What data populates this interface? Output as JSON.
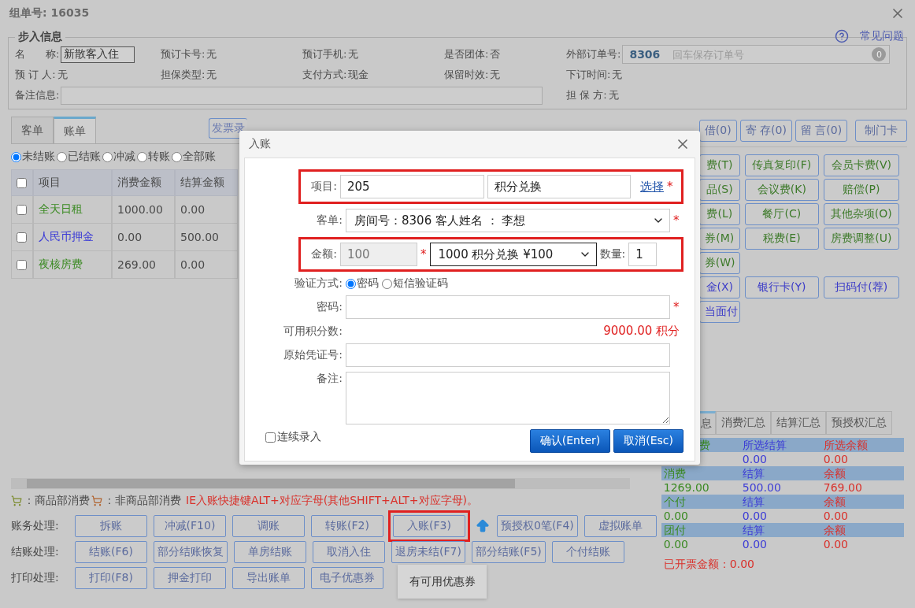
{
  "window": {
    "title": "组单号: 16035"
  },
  "help_link": "常见问题",
  "checkin_info": {
    "legend": "步入信息",
    "rows": [
      [
        {
          "kind": "input",
          "label": "名　　称:",
          "value": "新散客入住"
        },
        {
          "kind": "text",
          "label": "预订卡号:",
          "value": "无"
        },
        {
          "kind": "text",
          "label": "预订手机:",
          "value": "无"
        },
        {
          "kind": "text",
          "label": "是否团体:",
          "value": "否"
        },
        {
          "kind": "order",
          "label": "外部订单号:",
          "value": "8306",
          "placeholder": "回车保存订单号",
          "badge": "0"
        }
      ],
      [
        {
          "kind": "text",
          "label": "预 订 人:",
          "value": "无"
        },
        {
          "kind": "text",
          "label": "担保类型:",
          "value": "无"
        },
        {
          "kind": "text",
          "label": "支付方式:",
          "value": "现金"
        },
        {
          "kind": "text",
          "label": "保留时效:",
          "value": "无"
        },
        {
          "kind": "text",
          "label": "下订时间:",
          "value": "无"
        }
      ],
      [
        {
          "kind": "wide",
          "label": "备注信息:"
        },
        "",
        "",
        "",
        {
          "kind": "text",
          "label": "担 保 方:",
          "value": "无"
        }
      ]
    ]
  },
  "tabs": [
    {
      "label": "客单",
      "selected": false
    },
    {
      "label": "账单",
      "selected": true
    }
  ],
  "invoice_button": "发票录",
  "filters": [
    {
      "label": "未结账",
      "selected": true
    },
    {
      "label": "已结账",
      "selected": false
    },
    {
      "label": "冲减",
      "selected": false
    },
    {
      "label": "转账",
      "selected": false
    },
    {
      "label": "全部账",
      "selected": false
    }
  ],
  "bill_table": {
    "select_all": {
      "checked": false
    },
    "columns": [
      "项目",
      "消费金额",
      "结算金额"
    ],
    "rows": [
      {
        "checked": false,
        "item": "全天日租",
        "color": "#3a8a22",
        "consumed": "1000.00",
        "settled": "0.00"
      },
      {
        "checked": false,
        "item": "人民币押金",
        "color": "#3b3bd6",
        "consumed": "0.00",
        "settled": "500.00"
      },
      {
        "checked": false,
        "item": "夜核房费",
        "color": "#3a8a22",
        "consumed": "269.00",
        "settled": "0.00"
      }
    ]
  },
  "legend": {
    "goods": "：商品部消费",
    "non_goods": "：非商品部消费",
    "hint": "IE入账快捷键ALT+对应字母(其他SHIFT+ALT+对应字母)。"
  },
  "action_rows": [
    {
      "label": "账务处理:",
      "buttons": [
        {
          "kind": "button",
          "label": "拆账",
          "highlighted": false
        },
        {
          "kind": "button",
          "label": "冲减(F10)",
          "highlighted": false
        },
        {
          "kind": "button",
          "label": "调账",
          "highlighted": false
        },
        {
          "kind": "button",
          "label": "转账(F2)",
          "highlighted": false
        },
        {
          "kind": "button",
          "label": "入账(F3)",
          "highlighted": true
        },
        {
          "kind": "arrow"
        },
        {
          "kind": "button",
          "label": "预授权0笔(F4)",
          "highlighted": false
        },
        {
          "kind": "button",
          "label": "虚拟账单",
          "highlighted": false
        }
      ]
    },
    {
      "label": "结账处理:",
      "buttons": [
        {
          "kind": "button",
          "label": "结账(F6)",
          "highlighted": false
        },
        {
          "kind": "button",
          "label": "部分结账恢复",
          "highlighted": false
        },
        {
          "kind": "button",
          "label": "单房结账",
          "highlighted": false
        },
        {
          "kind": "button",
          "label": "取消入住",
          "highlighted": false
        },
        {
          "kind": "button",
          "label": "退房未结(F7)",
          "highlighted": false
        },
        {
          "kind": "button",
          "label": "部分结账(F5)",
          "highlighted": false
        },
        {
          "kind": "button",
          "label": "个付结账",
          "highlighted": false
        }
      ]
    },
    {
      "label": "打印处理:",
      "buttons": [
        {
          "kind": "button",
          "label": "打印(F8)",
          "highlighted": false
        },
        {
          "kind": "button",
          "label": "押金打印",
          "highlighted": false
        },
        {
          "kind": "button",
          "label": "导出账单",
          "highlighted": false
        },
        {
          "kind": "button",
          "label": "电子优惠券",
          "highlighted": false
        }
      ],
      "tooltip": "有可用优惠券"
    }
  ],
  "top_buttons": [
    "借(0)",
    "寄 存(0)",
    "留 言(0)",
    "制门卡"
  ],
  "charge_rows": [
    {
      "kind": "charge",
      "buttons": [
        "费(T)",
        "传真复印(F)",
        "会员卡费(V)"
      ]
    },
    {
      "kind": "charge",
      "buttons": [
        "品(S)",
        "会议费(K)",
        "赔偿(P)"
      ]
    },
    {
      "kind": "charge",
      "buttons": [
        "费(L)",
        "餐厅(C)",
        "其他杂项(O)"
      ]
    },
    {
      "kind": "charge",
      "buttons": [
        "券(M)",
        "税费(E)",
        "房费调整(U)"
      ]
    },
    {
      "kind": "charge",
      "buttons": [
        "券(W)"
      ]
    },
    {
      "kind": "payment",
      "buttons": [
        "金(X)",
        "银行卡(Y)",
        "扫码付(荐)"
      ]
    },
    {
      "kind": "payment",
      "buttons": [
        "当面付"
      ]
    }
  ],
  "summary": {
    "tabs": [
      {
        "label": "息",
        "selected": true
      },
      {
        "label": "消费汇总",
        "selected": false
      },
      {
        "label": "结算汇总",
        "selected": false
      },
      {
        "label": "预授权汇总",
        "selected": false
      }
    ],
    "rows": [
      {
        "kind": "header",
        "first": "费",
        "second": "所选结算",
        "third": "所选余额"
      },
      {
        "kind": "value",
        "second": "0.00",
        "third": "0.00"
      },
      {
        "kind": "header",
        "first": "消费",
        "second": "结算",
        "third": "余额"
      },
      {
        "kind": "value",
        "first": "1269.00",
        "second": "500.00",
        "third": "769.00"
      },
      {
        "kind": "header",
        "first": "个付",
        "second": "结算",
        "third": "余额"
      },
      {
        "kind": "value",
        "first": "0.00",
        "second": "0.00",
        "third": "0.00"
      },
      {
        "kind": "header",
        "first": "团付",
        "second": "结算",
        "third": "余额"
      },
      {
        "kind": "value",
        "first": "0.00",
        "second": "0.00",
        "third": "0.00"
      }
    ],
    "invoiced": "已开票金额：0.00"
  },
  "dialog": {
    "title": "入账",
    "fields": [
      {
        "kind": "item",
        "label": "项目:",
        "code": "205",
        "name": "积分兑换",
        "link": "选择",
        "mark": "*",
        "highlighted": true
      },
      {
        "kind": "select",
        "label": "客单:",
        "value": "房间号：8306 客人姓名 ： 李想",
        "mark": "*",
        "highlighted": false
      },
      {
        "kind": "amount",
        "label": "金额:",
        "value": "100",
        "disabled": true,
        "mark": "*",
        "option": "1000 积分兑换 ¥100",
        "qty_label": "数量:",
        "qty": "1",
        "highlighted": true
      },
      {
        "kind": "radio",
        "label": "验证方式:",
        "options": [
          {
            "label": "密码",
            "selected": true
          },
          {
            "label": "短信验证码",
            "selected": false
          }
        ],
        "highlighted": false
      },
      {
        "kind": "input",
        "label": "密码:",
        "mark": "*",
        "highlighted": false
      },
      {
        "kind": "reading",
        "label": "可用积分数:",
        "value": "9000.00 积分",
        "highlighted": false
      },
      {
        "kind": "input",
        "label": "原始凭证号:",
        "highlighted": false
      },
      {
        "kind": "textarea",
        "label": "备注:",
        "highlighted": false
      }
    ],
    "continuous": {
      "label": "连续录入",
      "checked": false
    },
    "buttons": [
      "确认(Enter)",
      "取消(Esc)"
    ]
  }
}
